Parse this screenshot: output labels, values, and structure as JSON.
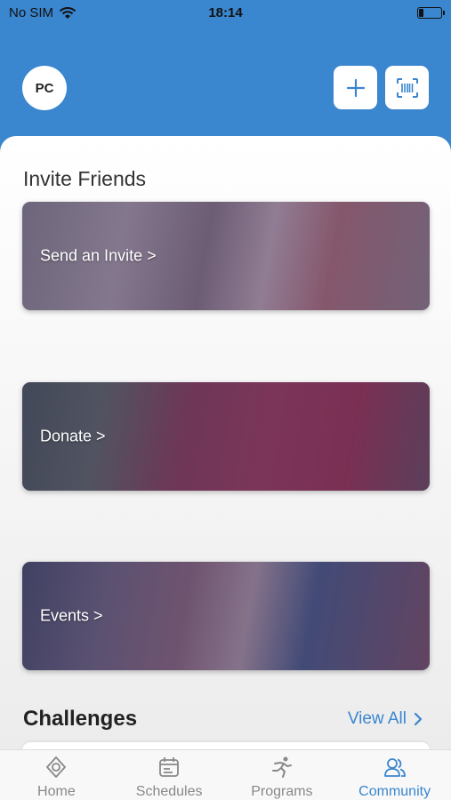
{
  "status_bar": {
    "carrier": "No SIM",
    "time": "18:14",
    "battery_level_percent": 20
  },
  "header": {
    "avatar_initials": "PC",
    "add_icon": "plus-icon",
    "scan_icon": "barcode-scan-icon"
  },
  "invite_section": {
    "title": "Invite Friends"
  },
  "cards": [
    {
      "label": "Send an Invite >"
    },
    {
      "label": "Donate >"
    },
    {
      "label": "Events >"
    }
  ],
  "challenges": {
    "title": "Challenges",
    "view_all": "View All"
  },
  "tabbar": {
    "items": [
      {
        "label": "Home",
        "icon": "home-icon"
      },
      {
        "label": "Schedules",
        "icon": "calendar-icon"
      },
      {
        "label": "Programs",
        "icon": "runner-icon"
      },
      {
        "label": "Community",
        "icon": "community-icon",
        "active": true
      }
    ]
  },
  "colors": {
    "brand_blue": "#3a86cf",
    "tab_inactive": "#888888"
  }
}
